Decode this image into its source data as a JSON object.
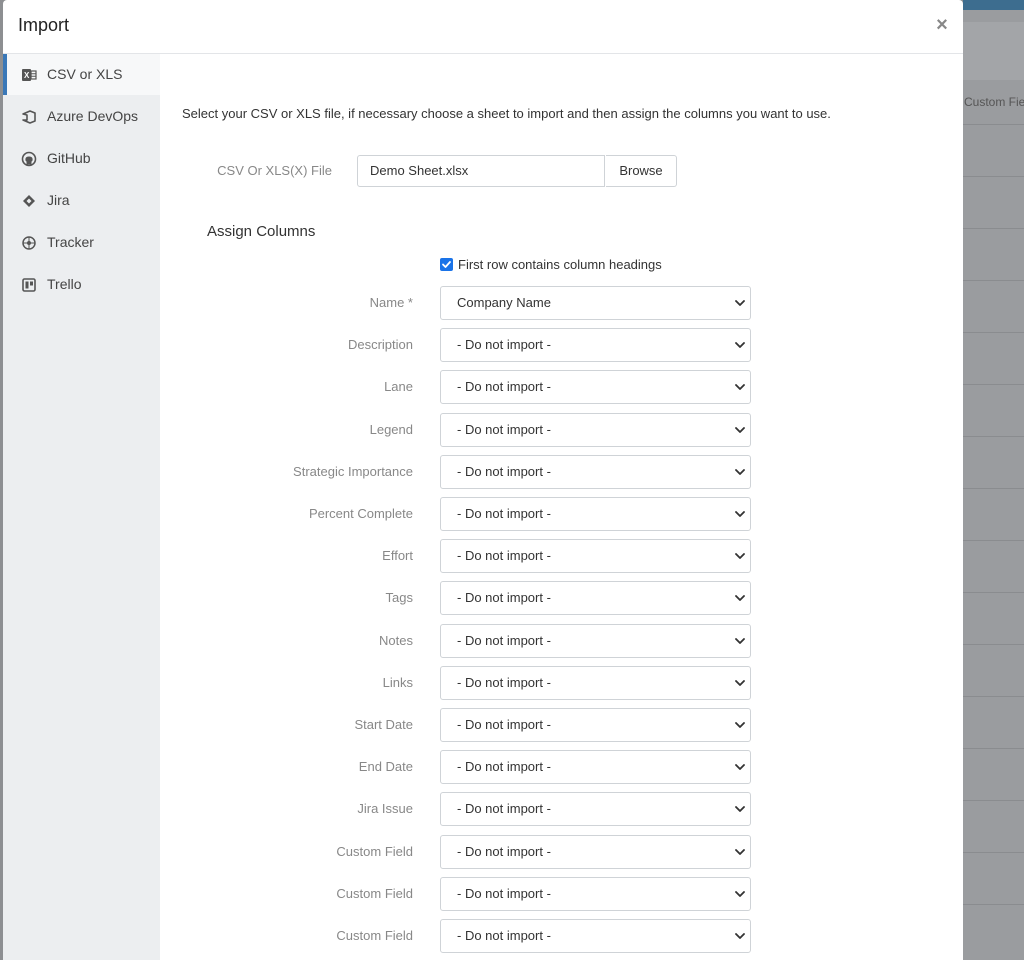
{
  "background": {
    "header_text": "Custom Fie"
  },
  "modal": {
    "title": "Import",
    "close_label": "×"
  },
  "sidebar": {
    "items": [
      {
        "label": "CSV or XLS",
        "icon": "excel-icon",
        "active": true
      },
      {
        "label": "Azure DevOps",
        "icon": "azure-devops-icon",
        "active": false
      },
      {
        "label": "GitHub",
        "icon": "github-icon",
        "active": false
      },
      {
        "label": "Jira",
        "icon": "jira-icon",
        "active": false
      },
      {
        "label": "Tracker",
        "icon": "tracker-icon",
        "active": false
      },
      {
        "label": "Trello",
        "icon": "trello-icon",
        "active": false
      }
    ]
  },
  "content": {
    "intro": "Select your CSV or XLS file, if necessary choose a sheet to import and then assign the columns you want to use.",
    "file_label": "CSV Or XLS(X) File",
    "file_value": "Demo Sheet.xlsx",
    "browse_label": "Browse",
    "assign_title": "Assign Columns",
    "first_row_label": "First row contains column headings",
    "first_row_checked": true
  },
  "mappings": [
    {
      "label": "Name *",
      "value": "Company Name"
    },
    {
      "label": "Description",
      "value": "- Do not import -"
    },
    {
      "label": "Lane",
      "value": "- Do not import -"
    },
    {
      "label": "Legend",
      "value": "- Do not import -"
    },
    {
      "label": "Strategic Importance",
      "value": "- Do not import -"
    },
    {
      "label": "Percent Complete",
      "value": "- Do not import -"
    },
    {
      "label": "Effort",
      "value": "- Do not import -"
    },
    {
      "label": "Tags",
      "value": "- Do not import -"
    },
    {
      "label": "Notes",
      "value": "- Do not import -"
    },
    {
      "label": "Links",
      "value": "- Do not import -"
    },
    {
      "label": "Start Date",
      "value": "- Do not import -"
    },
    {
      "label": "End Date",
      "value": "- Do not import -"
    },
    {
      "label": "Jira Issue",
      "value": "- Do not import -"
    },
    {
      "label": "Custom Field",
      "value": "- Do not import -"
    },
    {
      "label": "Custom Field",
      "value": "- Do not import -"
    },
    {
      "label": "Custom Field",
      "value": "- Do not import -"
    }
  ],
  "colors": {
    "accent": "#3a78b8",
    "checkbox": "#1a73e8",
    "sidebar_bg": "#eceef0"
  }
}
